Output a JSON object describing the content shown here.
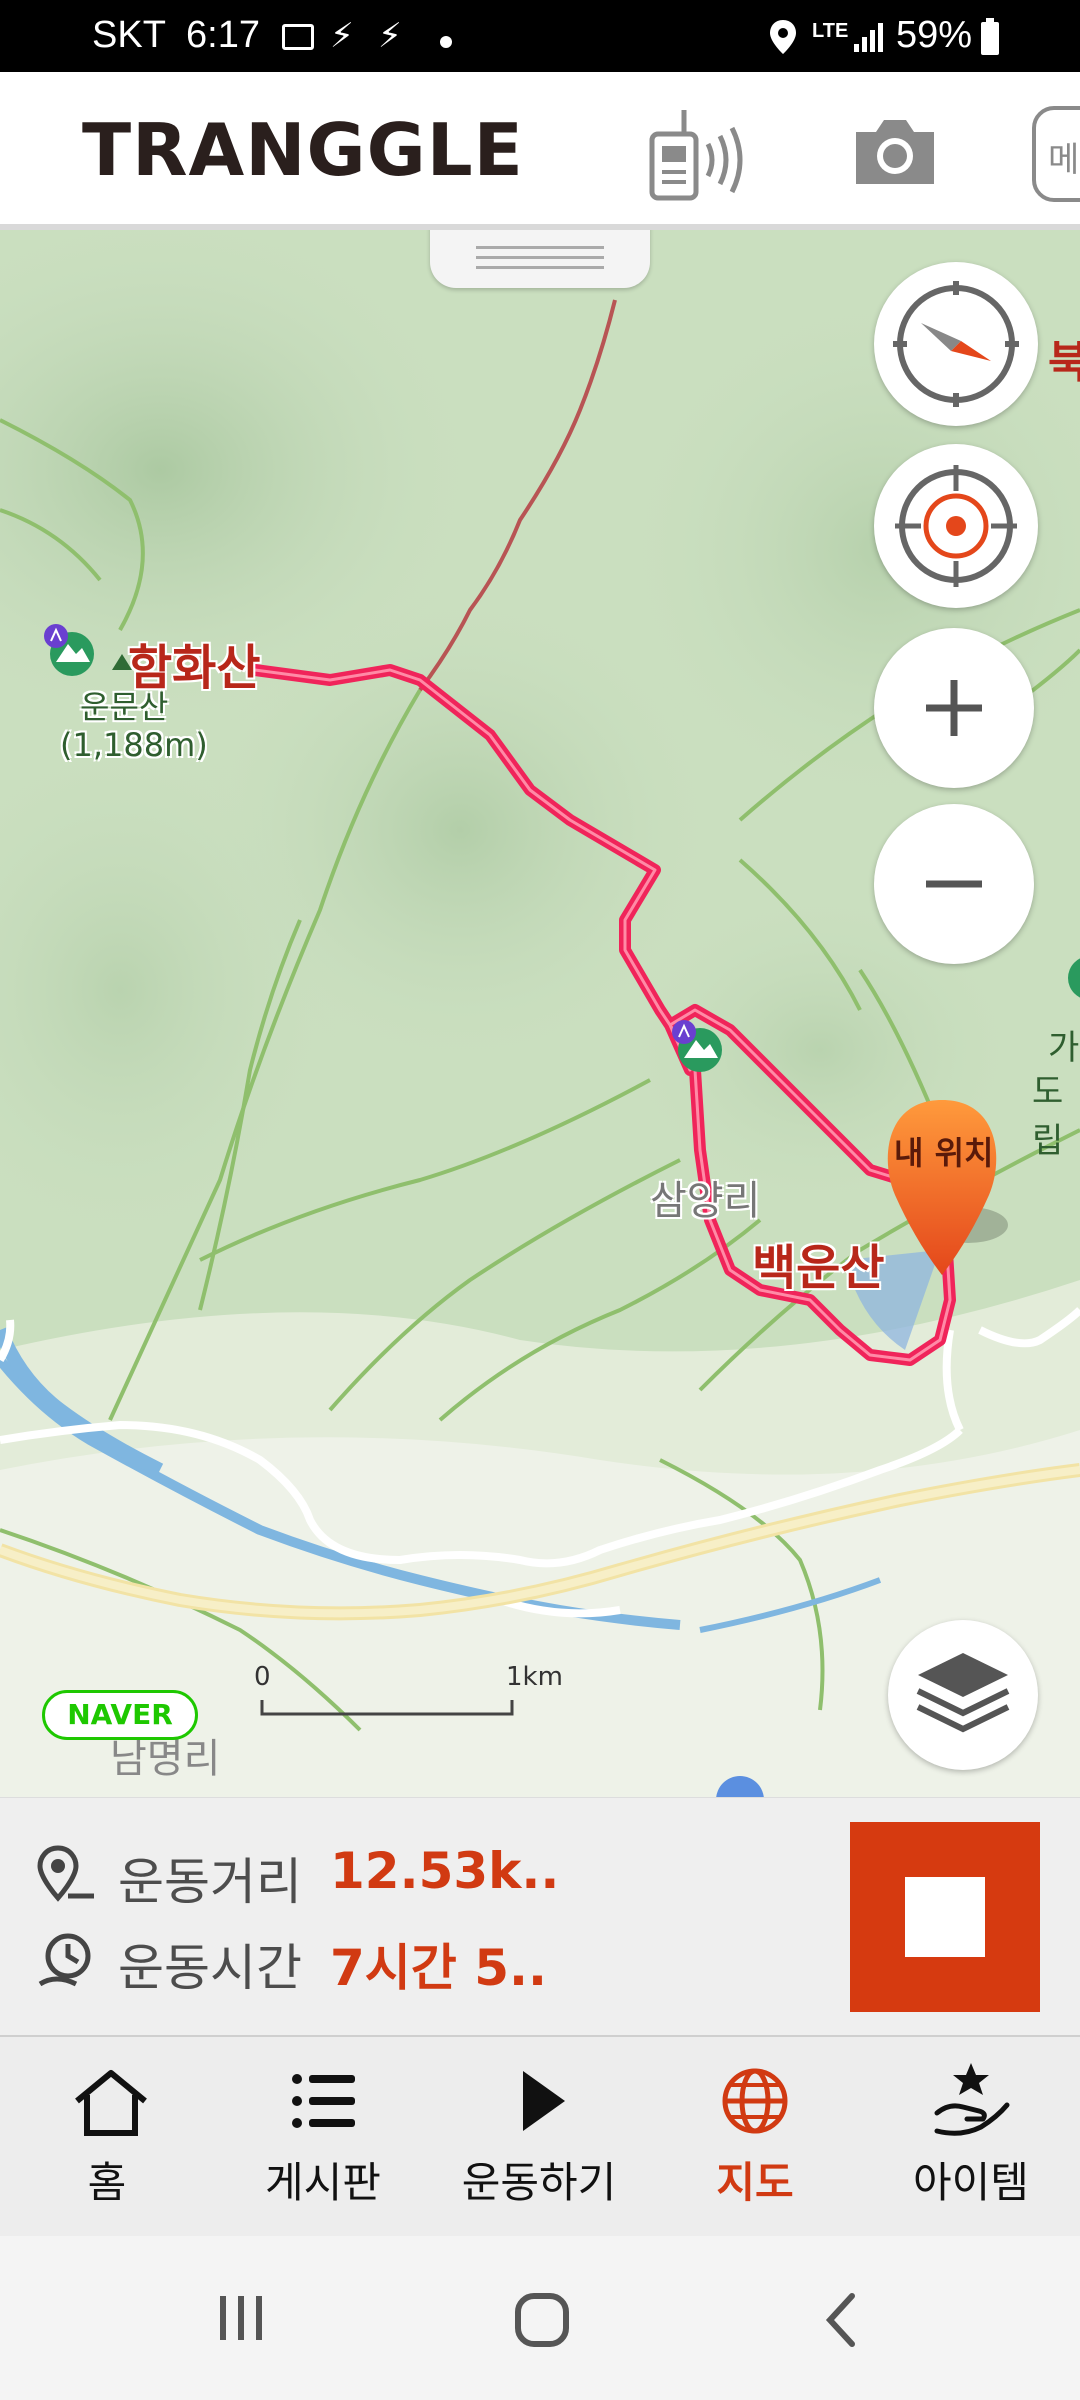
{
  "status_bar": {
    "carrier": "SKT",
    "time": "6:17",
    "network": "LTE",
    "battery": "59%"
  },
  "header": {
    "brand": "TRANGGLE",
    "menu_label": "메"
  },
  "map": {
    "labels": {
      "hamhwasan": "함화산",
      "unmunsan": "운문산",
      "unmunsan_elev": "(1,188m)",
      "samyangri": "삼양리",
      "baegunsan": "백운산",
      "my_location": "내 위치",
      "right_edge_top": "북",
      "right_edge_1": "가",
      "right_edge_2": "도립",
      "bottom_place": "남명리"
    },
    "scale": {
      "start": "0",
      "end": "1km"
    },
    "naver": "NAVER",
    "colors": {
      "route": "#f0245a",
      "accent": "#d13a12",
      "map_bg": "#cfe1c4"
    }
  },
  "stats": {
    "distance_label": "운동거리",
    "distance_value": "12.53k..",
    "time_label": "운동시간",
    "time_value": "7시간 5.."
  },
  "bottom_nav": {
    "items": [
      {
        "label": "홈",
        "icon": "home-icon"
      },
      {
        "label": "게시판",
        "icon": "list-icon"
      },
      {
        "label": "운동하기",
        "icon": "play-icon"
      },
      {
        "label": "지도",
        "icon": "globe-icon",
        "active": true
      },
      {
        "label": "아이템",
        "icon": "hand-star-icon"
      }
    ]
  }
}
